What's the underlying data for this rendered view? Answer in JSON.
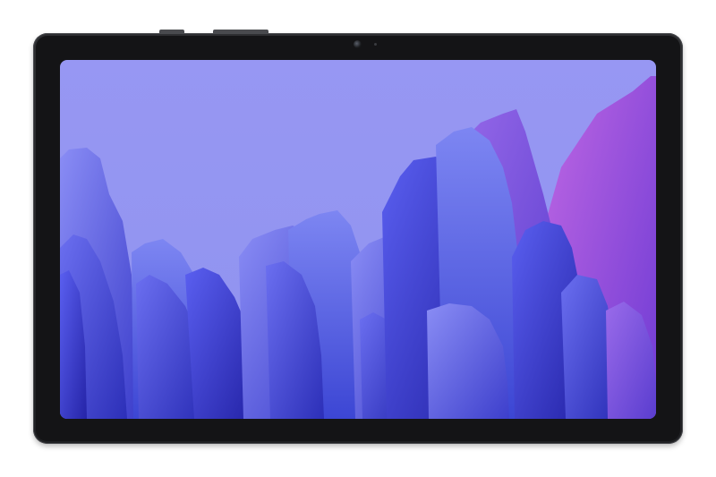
{
  "device": {
    "name": "tablet",
    "color": "#262729"
  },
  "wallpaper": {
    "sky_color": "#9595f2",
    "shape_colors": [
      "#3b38c9",
      "#4b4fd6",
      "#6d6bea",
      "#8b5ce0",
      "#b05fe0"
    ]
  }
}
